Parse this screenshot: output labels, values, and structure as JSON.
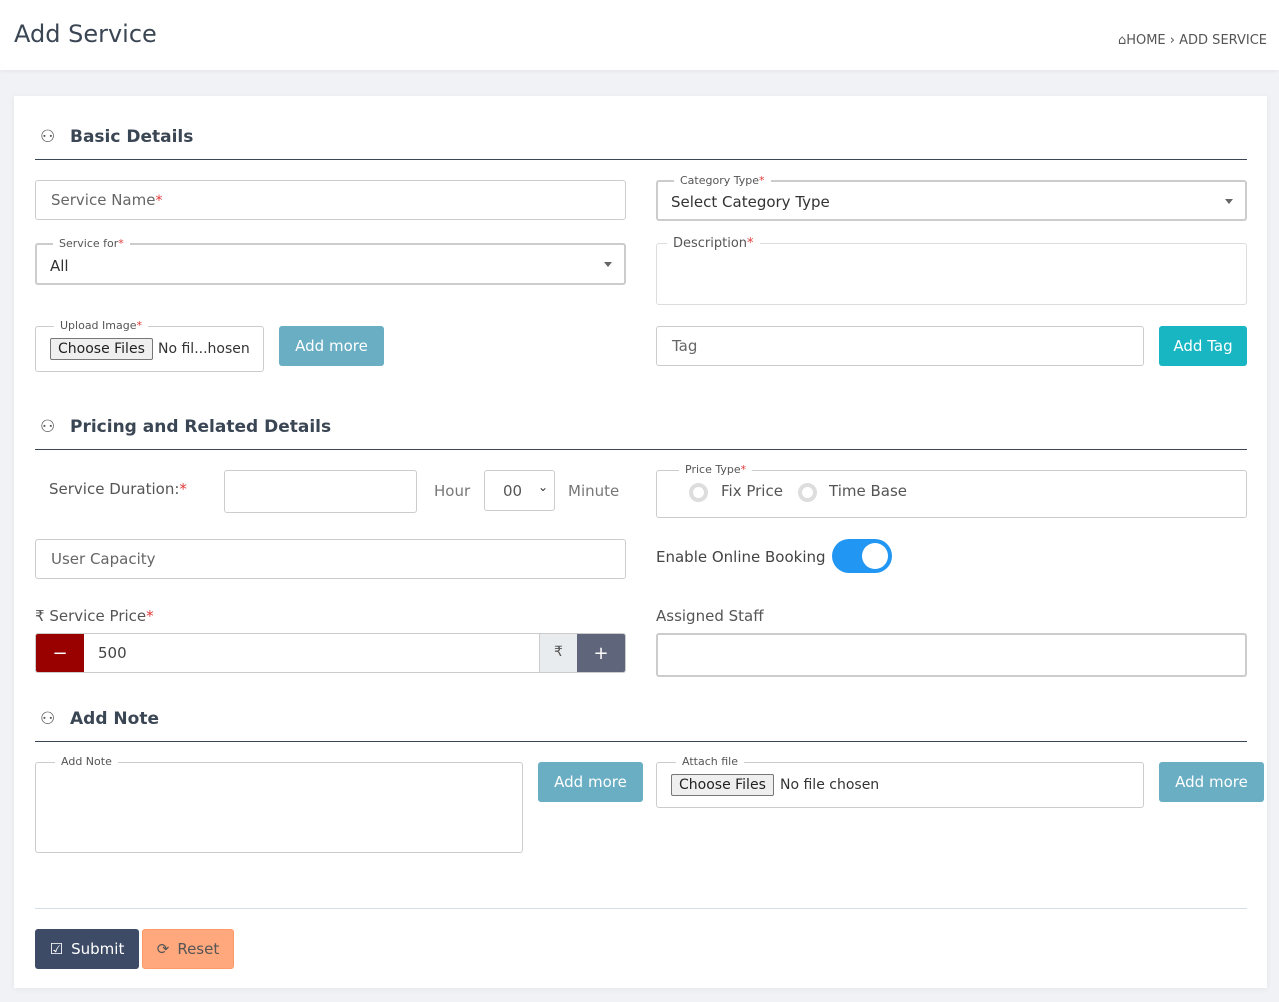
{
  "header": {
    "title": "Add Service",
    "breadcrumb": {
      "home": "HOME",
      "separator": "›",
      "current": "ADD SERVICE"
    }
  },
  "sections": {
    "basic": "Basic Details",
    "pricing": "Pricing and Related Details",
    "note": "Add Note"
  },
  "basic": {
    "service_name_placeholder": "Service Name",
    "category_label": "Category Type",
    "category_value": "Select Category Type",
    "service_for_label": "Service for",
    "service_for_value": "All",
    "description_label": "Description",
    "upload_label": "Upload Image",
    "choose_files": "Choose Files",
    "no_file": "No fil...hosen",
    "add_more": "Add more",
    "tag_placeholder": "Tag",
    "add_tag": "Add Tag"
  },
  "pricing": {
    "duration_label": "Service Duration:",
    "hour": "Hour",
    "minute_value": "00",
    "minute": "Minute",
    "price_type_label": "Price Type",
    "fix_price": "Fix Price",
    "time_base": "Time Base",
    "user_capacity_placeholder": "User Capacity",
    "online_booking_label": "Enable Online Booking",
    "online_booking_enabled": true,
    "service_price_label": "Service Price",
    "currency": "₹",
    "price_value": "500",
    "minus": "−",
    "plus": "+",
    "assigned_staff_label": "Assigned Staff"
  },
  "note": {
    "add_note_label": "Add Note",
    "add_more": "Add more",
    "attach_label": "Attach file",
    "choose_files": "Choose Files",
    "no_file": "No file chosen",
    "add_more_2": "Add more"
  },
  "actions": {
    "submit": "Submit",
    "reset": "Reset"
  },
  "required_mark": "*",
  "colors": {
    "primary_dark": "#3e4b66",
    "teal": "#6aaec3",
    "add_tag": "#17b6c2",
    "reset": "#ffa87d",
    "minus": "#990000",
    "plus": "#5f657a",
    "toggle": "#2196f3"
  }
}
